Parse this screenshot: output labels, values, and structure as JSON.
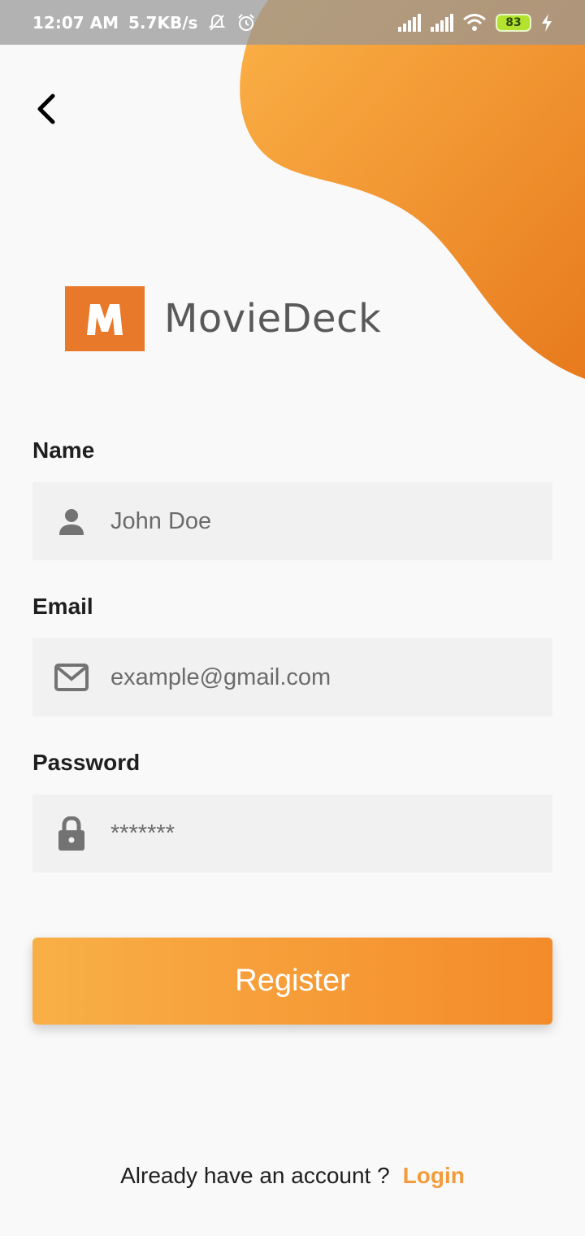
{
  "status_bar": {
    "time": "12:07 AM",
    "network_speed": "5.7KB/s",
    "battery_level": "83",
    "icons_left": [
      "muted-bell-icon",
      "alarm-icon"
    ],
    "icons_right": [
      "signal-icon",
      "signal-icon",
      "wifi-icon",
      "battery-icon",
      "charging-icon"
    ]
  },
  "header": {
    "back_icon": "chevron-left-icon"
  },
  "logo": {
    "mark": "M",
    "text": "MovieDeck",
    "brand_color": "#e8792a"
  },
  "form": {
    "name": {
      "label": "Name",
      "value": "John Doe",
      "icon": "person-icon"
    },
    "email": {
      "label": "Email",
      "placeholder": "example@gmail.com",
      "icon": "mail-icon"
    },
    "password": {
      "label": "Password",
      "placeholder": "*******",
      "icon": "lock-icon"
    }
  },
  "register_button": {
    "label": "Register",
    "gradient": [
      "#f9af47",
      "#f48b2a"
    ]
  },
  "footer": {
    "prompt": "Already have an account ?",
    "link": "Login",
    "link_color": "#f29b3b"
  },
  "accent_colors": {
    "blob_start": "#fbb147",
    "blob_end": "#e77a1d"
  }
}
